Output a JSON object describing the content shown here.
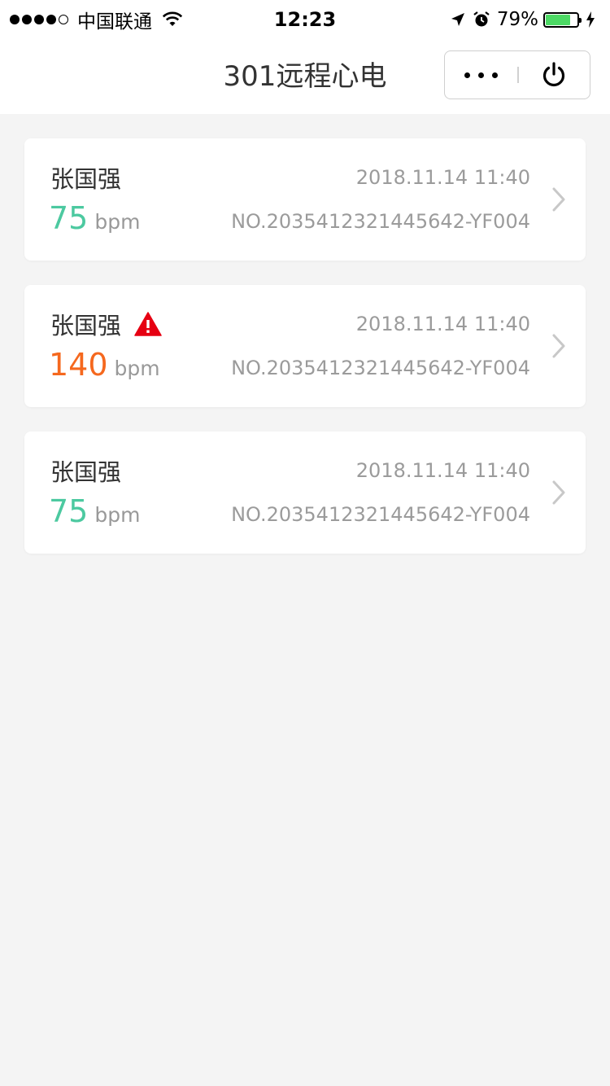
{
  "status_bar": {
    "carrier": "中国联通",
    "time": "12:23",
    "battery_percent": "79%",
    "battery_level": 0.79,
    "signal_bars_filled": 4,
    "signal_bars_total": 5
  },
  "nav": {
    "title": "301远程心电",
    "more_icon": "more-dots-icon",
    "close_icon": "power-icon"
  },
  "colors": {
    "normal_bpm": "#4cc9a0",
    "alert_bpm": "#f5681e",
    "warning_icon": "#e60012",
    "background": "#f4f4f4"
  },
  "records": [
    {
      "name": "张国强",
      "warning": false,
      "bpm_value": "75",
      "bpm_unit": "bpm",
      "status": "normal",
      "time": "2018.11.14 11:40",
      "serial": "NO.2035412321445642-YF004"
    },
    {
      "name": "张国强",
      "warning": true,
      "bpm_value": "140",
      "bpm_unit": "bpm",
      "status": "alert",
      "time": "2018.11.14 11:40",
      "serial": "NO.2035412321445642-YF004"
    },
    {
      "name": "张国强",
      "warning": false,
      "bpm_value": "75",
      "bpm_unit": "bpm",
      "status": "normal",
      "time": "2018.11.14 11:40",
      "serial": "NO.2035412321445642-YF004"
    }
  ]
}
